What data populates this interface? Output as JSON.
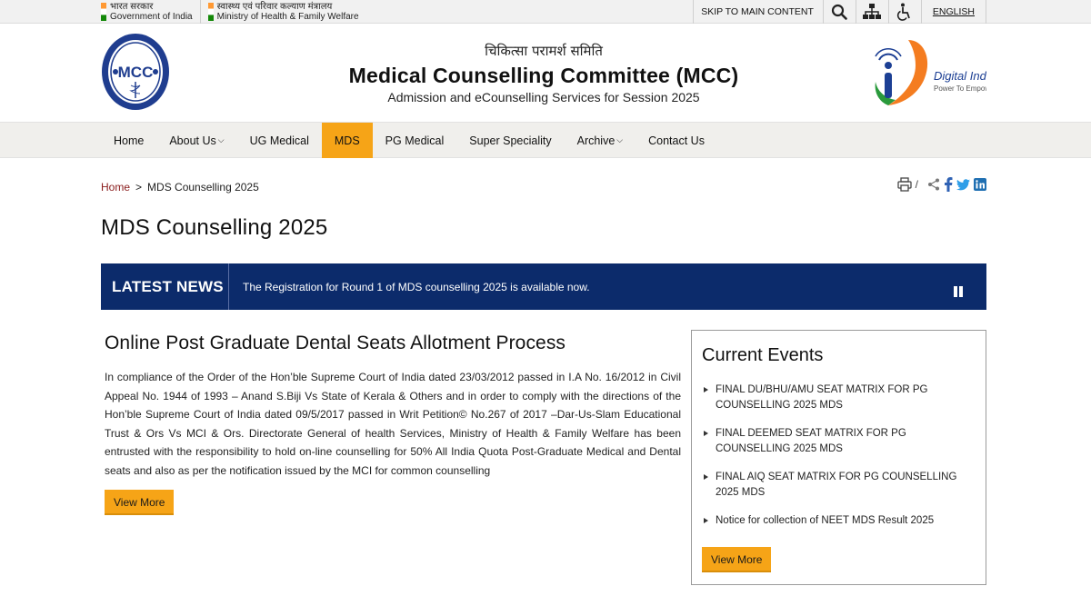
{
  "gov_bar": {
    "gov_hindi": "भारत सरकार",
    "gov_english": "Government of India",
    "ministry_hindi": "स्वास्थ्य एवं परिवार कल्याण मंत्रालय",
    "ministry_english": "Ministry of Health & Family Welfare",
    "skip_label": "SKIP TO MAIN CONTENT",
    "language_label": "ENGLISH"
  },
  "header": {
    "hindi_title": "चिकित्सा परामर्श समिति",
    "title": "Medical Counselling Committee (MCC)",
    "subtitle": "Admission and eCounselling Services for Session 2025",
    "logo_text": "MCC",
    "logo_ring_text": "MEDICAL COUNSELLING COMMITTEE",
    "digital_india": "Digital India",
    "digital_india_tagline": "Power To Empower"
  },
  "nav": {
    "items": [
      {
        "label": "Home"
      },
      {
        "label": "About Us"
      },
      {
        "label": "UG Medical"
      },
      {
        "label": "MDS"
      },
      {
        "label": "PG Medical"
      },
      {
        "label": "Super Speciality"
      },
      {
        "label": "Archive"
      },
      {
        "label": "Contact Us"
      }
    ]
  },
  "breadcrumb": {
    "home": "Home",
    "separator": ">",
    "current": "MDS Counselling 2025"
  },
  "page_title": "MDS Counselling 2025",
  "news": {
    "label": "LATEST NEWS",
    "text": "The Registration for Round 1 of MDS counselling 2025 is available now."
  },
  "main": {
    "heading": "Online Post Graduate Dental Seats Allotment Process",
    "body": "In compliance of the Order of the Hon’ble Supreme Court of India dated 23/03/2012 passed in I.A No. 16/2012 in Civil Appeal No. 1944 of 1993 – Anand S.Biji Vs State of Kerala & Others and in order to comply with the directions of the Hon’ble Supreme Court of India dated 09/5/2017 passed in Writ Petition© No.267 of 2017 –Dar-Us-Slam Educational Trust & Ors Vs MCI & Ors. Directorate General of health Services, Ministry of Health & Family Welfare has been entrusted with the responsibility to hold on-line counselling for 50% All India Quota Post-Graduate Medical and Dental seats and also as per the notification issued by the MCI for common counselling",
    "view_more": "View More"
  },
  "events": {
    "heading": "Current Events",
    "items": [
      {
        "text": "FINAL DU/BHU/AMU SEAT MATRIX FOR PG COUNSELLING 2025 MDS"
      },
      {
        "text": "FINAL DEEMED SEAT MATRIX FOR PG COUNSELLING 2025 MDS"
      },
      {
        "text": "FINAL AIQ SEAT MATRIX FOR PG COUNSELLING 2025 MDS"
      },
      {
        "text": "Notice for collection of NEET MDS Result 2025"
      }
    ],
    "view_more": "View More"
  },
  "colors": {
    "accent": "#f6a417",
    "news_bg": "#0c2b6b",
    "breadcrumb_home": "#8a1c1c"
  },
  "icons": {
    "search": "search-icon",
    "sitemap": "sitemap-icon",
    "accessibility": "accessibility-icon",
    "print": "print-icon",
    "share": "share-icon",
    "facebook": "facebook-icon",
    "twitter": "twitter-icon",
    "linkedin": "linkedin-icon",
    "pause": "pause-icon"
  }
}
